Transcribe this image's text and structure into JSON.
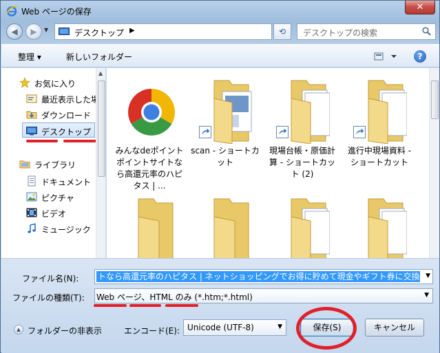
{
  "window": {
    "title": "Web ページの保存",
    "close_label": "✕"
  },
  "navbar": {
    "location": "デスクトップ",
    "search_placeholder": "デスクトップの検索"
  },
  "toolbar": {
    "organize": "整理 ▾",
    "new_folder": "新しいフォルダー"
  },
  "nav_pane": {
    "items": [
      {
        "label": "お気に入り"
      },
      {
        "label": "最近表示した場"
      },
      {
        "label": "ダウンロード"
      },
      {
        "label": "デスクトップ"
      },
      {
        "label": "ライブラリ"
      },
      {
        "label": "ドキュメント"
      },
      {
        "label": "ピクチャ"
      },
      {
        "label": "ビデオ"
      },
      {
        "label": "ミュージック"
      }
    ]
  },
  "files": [
    {
      "caption": "みんなdeポイント ポイントサイトなら高還元率のハピタス | ..."
    },
    {
      "caption": "scan - ショートカット"
    },
    {
      "caption": "現場台帳・原価計算 - ショートカット (2)"
    },
    {
      "caption": "進行中現場資料 - ショートカット"
    }
  ],
  "form": {
    "filename_label": "ファイル名(N):",
    "filename_value": "トなら高還元率のハピタス | ネットショッピングでお得に貯めて現金やギフト券に交換",
    "filetype_label": "ファイルの種類(T):",
    "filetype_value": "Web ページ、HTML のみ (*.htm;*.html)",
    "hide_folders": "フォルダーの非表示",
    "encoding_label": "エンコード(E):",
    "encoding_value": "Unicode (UTF-8)",
    "save_button": "保存(S)",
    "cancel_button": "キャンセル"
  },
  "colors": {
    "annotation_red": "#e0202a",
    "selection_blue": "#3399ff"
  }
}
